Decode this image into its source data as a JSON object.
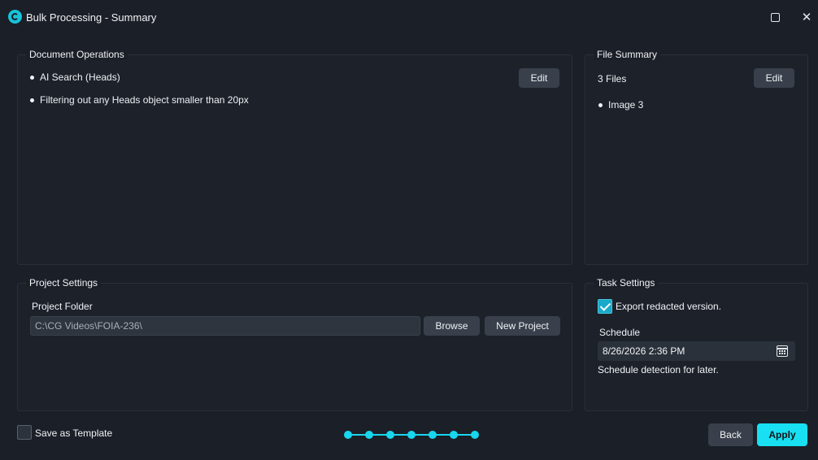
{
  "window": {
    "title": "Bulk Processing - Summary",
    "maximize_icon": "maximize-icon",
    "close_icon": "close-icon",
    "close_glyph": "✕"
  },
  "document_operations": {
    "title": "Document Operations",
    "items": [
      "AI Search (Heads)",
      "Filtering out any Heads object smaller than 20px"
    ],
    "edit_label": "Edit"
  },
  "file_summary": {
    "title": "File Summary",
    "count_label": "3 Files",
    "edit_label": "Edit",
    "items": [
      "Image 3"
    ]
  },
  "project_settings": {
    "title": "Project Settings",
    "folder_label": "Project Folder",
    "folder_value": "C:\\CG Videos\\FOIA-236\\",
    "browse_label": "Browse",
    "new_project_label": "New Project"
  },
  "task_settings": {
    "title": "Task Settings",
    "export_label": "Export redacted version.",
    "export_checked": true,
    "schedule_label": "Schedule",
    "schedule_value": "8/26/2026 2:36 PM",
    "schedule_hint": "Schedule detection for later."
  },
  "footer": {
    "save_template_label": "Save as Template",
    "save_template_checked": false,
    "back_label": "Back",
    "apply_label": "Apply",
    "steps_total": 7,
    "steps_completed": 7
  },
  "colors": {
    "accent": "#18e0f2",
    "background": "#1b1f27",
    "button": "#39404b"
  }
}
